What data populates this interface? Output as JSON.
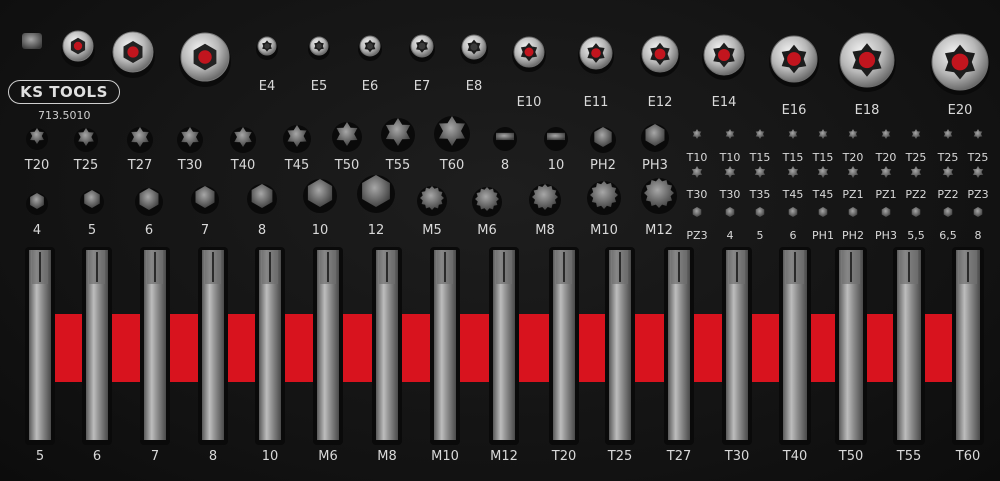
{
  "brand": {
    "logo_text": "KS TOOLS",
    "article_number": "713.5010"
  },
  "row_sockets": {
    "labels": [
      "E4",
      "E5",
      "E6",
      "E7",
      "E8",
      "E10",
      "E11",
      "E12",
      "E14",
      "E16",
      "E18",
      "E20"
    ]
  },
  "row_bits_a": {
    "labels": [
      "T20",
      "T25",
      "T27",
      "T30",
      "T40",
      "T45",
      "T50",
      "T55",
      "T60",
      "8",
      "10",
      "PH2",
      "PH3"
    ]
  },
  "row_bits_b": {
    "labels": [
      "4",
      "5",
      "6",
      "7",
      "8",
      "10",
      "12",
      "M5",
      "M6",
      "M8",
      "M10",
      "M12"
    ]
  },
  "small_bits": {
    "labels_r1": [
      "T10",
      "T10",
      "T15",
      "T15",
      "T15",
      "T20",
      "T20",
      "T25",
      "T25",
      "T25"
    ],
    "labels_r2": [
      "T30",
      "T30",
      "T35",
      "T45",
      "T45",
      "PZ1",
      "PZ1",
      "PZ2",
      "PZ2",
      "PZ3"
    ],
    "labels_r3": [
      "PZ3",
      "4",
      "5",
      "6",
      "PH1",
      "PH2",
      "PH3",
      "5,5",
      "6,5",
      "8"
    ]
  },
  "long_bits": {
    "labels": [
      "5",
      "6",
      "7",
      "8",
      "10",
      "M6",
      "M8",
      "M10",
      "M12",
      "T20",
      "T25",
      "T27",
      "T30",
      "T40",
      "T50",
      "T55",
      "T60"
    ]
  },
  "colors": {
    "foam": "#141414",
    "accent_red": "#d8131e",
    "steel": "#a9a9a9",
    "label": "#d9d9d9"
  }
}
